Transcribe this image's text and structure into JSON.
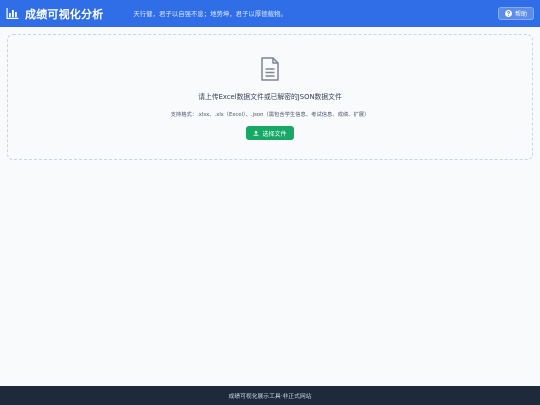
{
  "header": {
    "title": "成绩可视化分析",
    "slogan": "天行健，君子以自强不息；地势坤，君子以厚德载物。",
    "help_label": "帮助",
    "brand_icon": "bar-chart-icon",
    "help_icon": "question-circle-icon"
  },
  "upload": {
    "icon": "file-icon",
    "prompt": "请上传Excel数据文件或已解密的JSON数据文件",
    "formats": "支持格式：.xlsx、.xls（Excel）、.json（需包含学生信息、考试信息、成绩、扩展）",
    "button_label": "选择文件",
    "button_icon": "upload-icon"
  },
  "footer": {
    "text": "成绩可视化展示工具·非正式网站"
  },
  "colors": {
    "header_bg": "#2f6ee6",
    "button_green": "#17a865",
    "footer_bg": "#1e293b",
    "page_bg": "#f8fafc"
  }
}
